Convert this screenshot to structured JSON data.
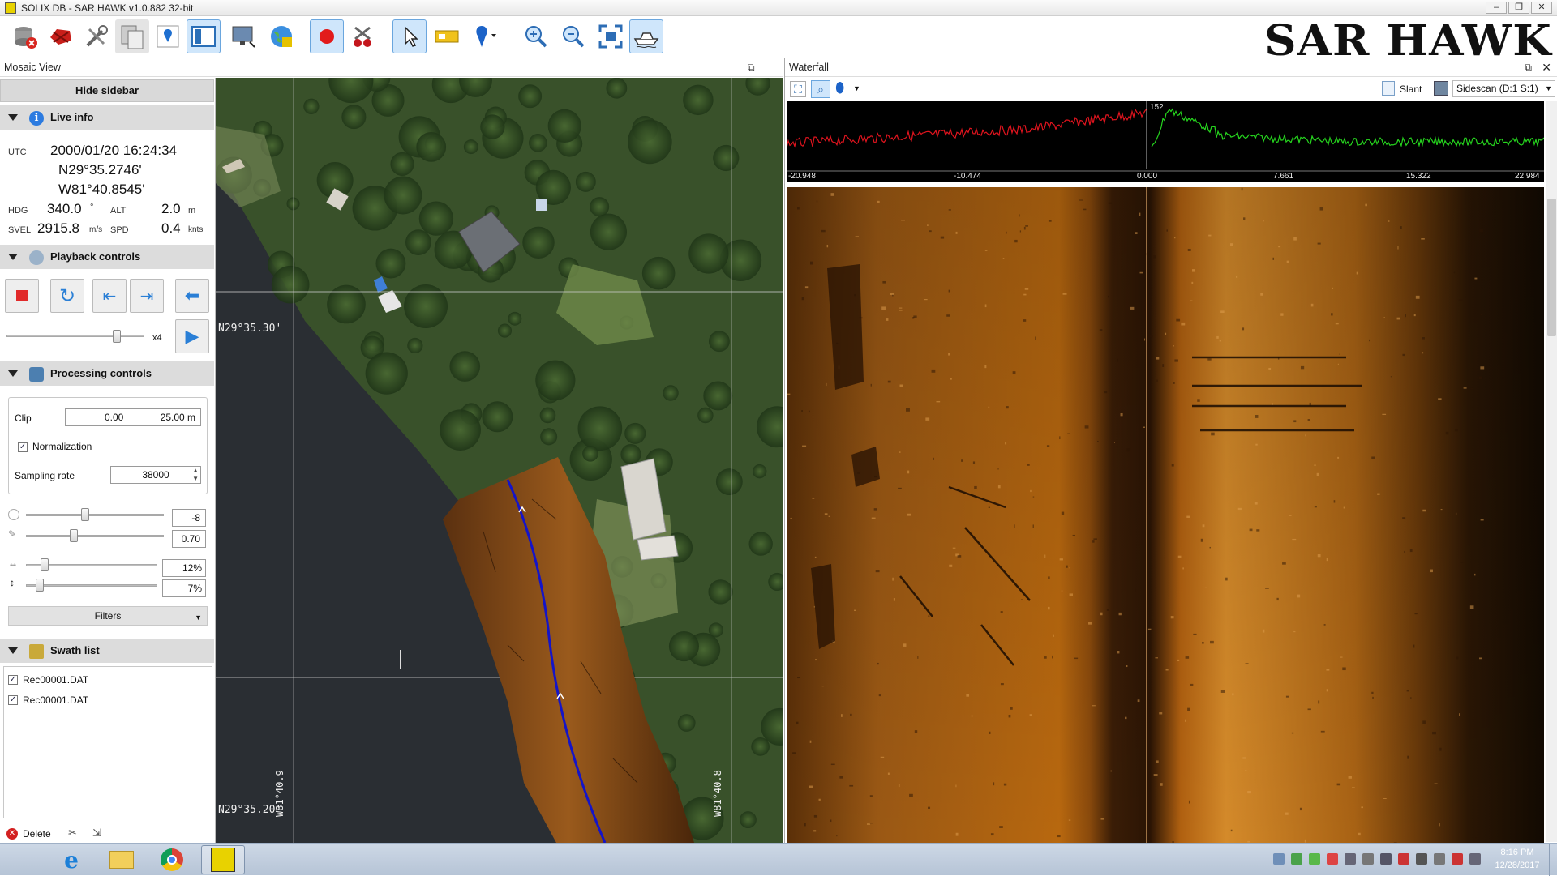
{
  "window": {
    "title": "SOLIX DB - SAR HAWK v1.0.882 32-bit",
    "brand": "SAR HAWK",
    "controls": [
      "–",
      "❐",
      "✕"
    ]
  },
  "toolbar": {
    "buttons": [
      "database-close",
      "record-delete",
      "tools",
      "copy",
      "marker",
      "sidebar-toggle",
      "screen",
      "globe",
      "record",
      "cherries",
      "pointer",
      "ruler",
      "waypoint",
      "zoom-in",
      "zoom-out",
      "fit",
      "boat"
    ],
    "active": [
      "sidebar-toggle",
      "record",
      "pointer",
      "boat"
    ]
  },
  "mosaic_panel": {
    "title": "Mosaic View",
    "hide_sidebar": "Hide sidebar"
  },
  "live_info": {
    "title": "Live info",
    "utc_label": "UTC",
    "utc": "2000/01/20 16:24:34",
    "lat": "N29°35.2746'",
    "lon": "W81°40.8545'",
    "hdg_label": "HDG",
    "hdg": "340.0",
    "hdg_unit": "°",
    "alt_label": "ALT",
    "alt": "2.0",
    "alt_unit": "m",
    "svel_label": "SVEL",
    "svel": "2915.8",
    "svel_unit": "m/s",
    "spd_label": "SPD",
    "spd": "0.4",
    "spd_unit": "knts"
  },
  "playback": {
    "title": "Playback controls",
    "speed": "x4",
    "speed_level": 0.8
  },
  "processing": {
    "title": "Processing controls",
    "clip_label": "Clip",
    "clip_min": "0.00",
    "clip_max": "25.00 m",
    "normalization_label": "Normalization",
    "normalization_checked": true,
    "sampling_label": "Sampling rate",
    "sampling_value": "38000",
    "slider1_value": "-8",
    "slider2_value": "0.70",
    "slider3_value": "12%",
    "slider4_value": "7%",
    "filters_label": "Filters"
  },
  "swath": {
    "title": "Swath list",
    "items": [
      {
        "name": "Rec00001.DAT",
        "checked": true
      },
      {
        "name": "Rec00001.DAT",
        "checked": true
      }
    ],
    "delete_label": "Delete"
  },
  "map": {
    "lat_label_top": "N29°35.30'",
    "lat_label_bottom": "N29°35.20'",
    "lon_label_left": "W81°40.9",
    "lon_label_right": "W81°40.8"
  },
  "waterfall": {
    "title": "Waterfall",
    "slant_label": "Slant",
    "mode_label": "Sidescan (D:1 S:1)",
    "center_marker": "152",
    "ticks": [
      "-20.948",
      "-10.474",
      "0.000",
      "7.661",
      "15.322",
      "22.984"
    ],
    "colors": {
      "port": "#e0141e",
      "starboard": "#26d61e",
      "sonar": "#b8680f"
    }
  },
  "taskbar": {
    "apps": [
      "internet-explorer",
      "file-explorer",
      "chrome",
      "sar-hawk"
    ],
    "time": "8:16 PM",
    "date": "12/28/2017"
  }
}
